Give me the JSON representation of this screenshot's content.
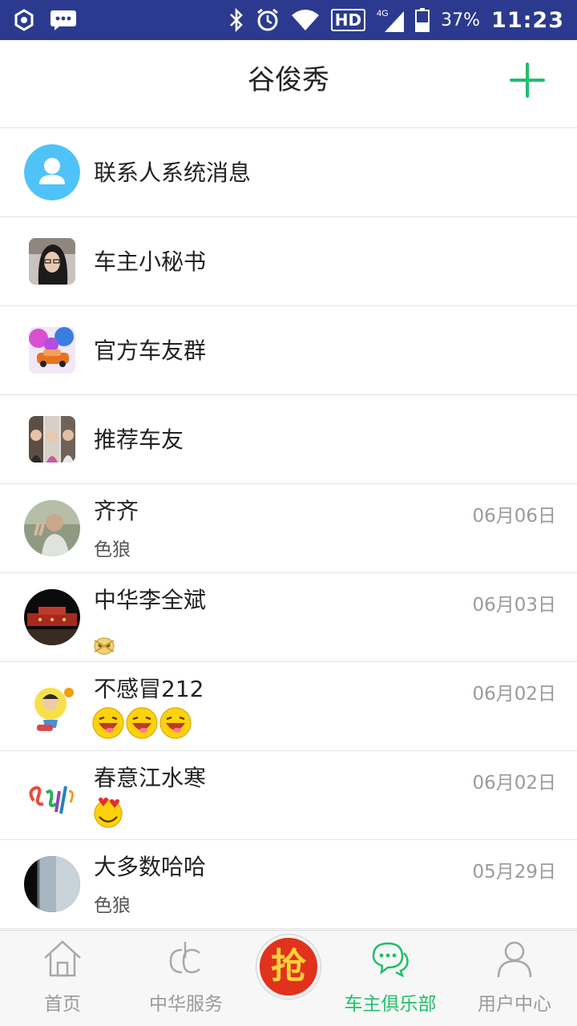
{
  "status_bar": {
    "network": "4G",
    "hd": "HD",
    "battery": "37%",
    "time": "11:23"
  },
  "header": {
    "title": "谷俊秀"
  },
  "chats": [
    {
      "name": "联系人系统消息",
      "avatar": "contact-system-icon"
    },
    {
      "name": "车主小秘书",
      "avatar": "secretary-avatar"
    },
    {
      "name": "官方车友群",
      "avatar": "group-car-avatar"
    },
    {
      "name": "推荐车友",
      "avatar": "recommended-friends-avatar"
    },
    {
      "name": "齐齐",
      "preview": "色狼",
      "date": "06月06日"
    },
    {
      "name": "中华李全斌",
      "preview_emoji": [
        "skull-emoji"
      ],
      "date": "06月03日"
    },
    {
      "name": "不感冒212",
      "preview_emoji": [
        "laughing-emoji",
        "laughing-emoji",
        "laughing-emoji"
      ],
      "date": "06月02日"
    },
    {
      "name": "春意江水寒",
      "preview_emoji": [
        "heart-eyes-emoji"
      ],
      "date": "06月02日"
    },
    {
      "name": "大多数哈哈",
      "preview": "色狼",
      "date": "05月29日"
    }
  ],
  "bottom_nav": {
    "items": [
      {
        "label": "首页",
        "icon": "home-icon"
      },
      {
        "label": "中华服务",
        "icon": "service-logo-icon"
      },
      {
        "label": "车主俱乐部",
        "icon": "chat-bubbles-icon",
        "active": true
      },
      {
        "label": "用户中心",
        "icon": "user-icon"
      }
    ],
    "center_button": "抢"
  },
  "colors": {
    "status_bar": "#2b3a8f",
    "accent": "#1fc06a",
    "grab_button": "#e0321c"
  }
}
